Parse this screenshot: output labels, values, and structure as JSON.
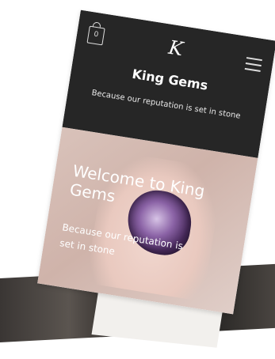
{
  "header": {
    "cart_count": "0",
    "logo_letter": "K",
    "brand": "King Gems",
    "tagline": "Because our reputation is set in stone"
  },
  "hero": {
    "title": "Welcome to King Gems",
    "subtitle": "Because our reputation is set in stone"
  },
  "icons": {
    "cart": "cart-icon",
    "menu": "hamburger-menu-icon",
    "logo": "king-gems-logo"
  },
  "colors": {
    "header_bg": "#262626",
    "hero_bg": "#d9c2ba"
  }
}
